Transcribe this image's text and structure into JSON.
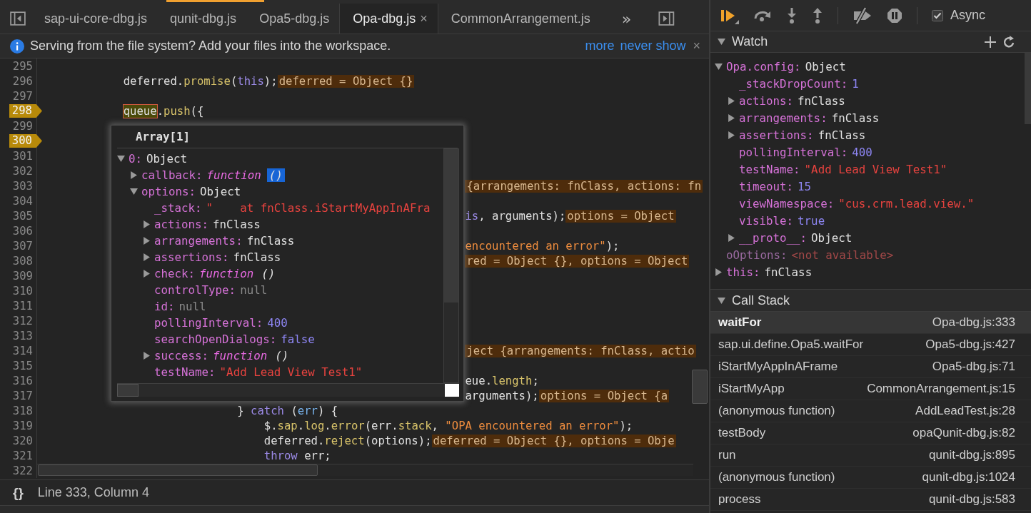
{
  "tabs": [
    {
      "label": "sap-ui-core-dbg.js",
      "selected": false
    },
    {
      "label": "qunit-dbg.js",
      "selected": false
    },
    {
      "label": "Opa5-dbg.js",
      "selected": false
    },
    {
      "label": "Opa-dbg.js",
      "selected": true,
      "close": "×"
    },
    {
      "label": "CommonArrangement.js",
      "selected": false
    }
  ],
  "tab_overflow": "»",
  "infobar": {
    "message": "Serving from the file system? Add your files into the workspace.",
    "links": [
      "more",
      "never show"
    ],
    "close": "×"
  },
  "code_lines": [
    {
      "number": "295",
      "breakpoint": false
    },
    {
      "number": "296",
      "breakpoint": false,
      "code": [
        {
          "kind": "plain",
          "t": "            deferred."
        },
        {
          "kind": "method",
          "t": "promise"
        },
        {
          "kind": "plain",
          "t": "("
        },
        {
          "kind": "keyword",
          "t": "this"
        },
        {
          "kind": "plain",
          "t": ");"
        }
      ],
      "value": "deferred = Object {}"
    },
    {
      "number": "297",
      "breakpoint": false
    },
    {
      "number": "298",
      "breakpoint": true,
      "code": [
        {
          "kind": "hover",
          "t": "            queue"
        },
        {
          "kind": "plain",
          "t": "."
        },
        {
          "kind": "method",
          "t": "push"
        },
        {
          "kind": "plain",
          "t": "({"
        }
      ]
    },
    {
      "number": "299",
      "breakpoint": false
    },
    {
      "number": "300",
      "breakpoint": true
    },
    {
      "number": "301",
      "breakpoint": false
    },
    {
      "number": "302",
      "breakpoint": false
    },
    {
      "number": "303",
      "breakpoint": false,
      "value": "                                                               {arrangements: fnClass, actions: fn"
    },
    {
      "number": "304",
      "breakpoint": false
    },
    {
      "number": "305",
      "breakpoint": false,
      "code": [
        {
          "kind": "keyword",
          "t": "                                                               is"
        },
        {
          "kind": "plain",
          "t": ", arguments);"
        }
      ],
      "value": "options = Object"
    },
    {
      "number": "306",
      "breakpoint": false
    },
    {
      "number": "307",
      "breakpoint": false,
      "code": [
        {
          "kind": "string",
          "t": "                                                               encountered an error\""
        },
        {
          "kind": "plain",
          "t": ");"
        }
      ]
    },
    {
      "number": "308",
      "breakpoint": false,
      "value": "                                                               red = Object {}, options = Object"
    },
    {
      "number": "309",
      "breakpoint": false
    },
    {
      "number": "310",
      "breakpoint": false
    },
    {
      "number": "311",
      "breakpoint": false
    },
    {
      "number": "312",
      "breakpoint": false
    },
    {
      "number": "313",
      "breakpoint": false
    },
    {
      "number": "314",
      "breakpoint": false,
      "value": "                                                               ject {arrangements: fnClass, actio"
    },
    {
      "number": "315",
      "breakpoint": false
    },
    {
      "number": "316",
      "breakpoint": false,
      "code": [
        {
          "kind": "plain",
          "t": "                                                               eue."
        },
        {
          "kind": "method",
          "t": "length"
        },
        {
          "kind": "plain",
          "t": ";"
        }
      ]
    },
    {
      "number": "317",
      "breakpoint": false,
      "code": [
        {
          "kind": "plain",
          "t": "                                                               arguments);"
        }
      ],
      "value": "options = Object {a"
    },
    {
      "number": "318",
      "breakpoint": false,
      "code": [
        {
          "kind": "plain",
          "t": "                             } "
        },
        {
          "kind": "keyword",
          "t": "catch"
        },
        {
          "kind": "plain",
          "t": " ("
        },
        {
          "kind": "param",
          "t": "err"
        },
        {
          "kind": "plain",
          "t": ") {"
        }
      ]
    },
    {
      "number": "319",
      "breakpoint": false,
      "code": [
        {
          "kind": "plain",
          "t": "                                 $."
        },
        {
          "kind": "method",
          "t": "sap"
        },
        {
          "kind": "plain",
          "t": "."
        },
        {
          "kind": "method",
          "t": "log"
        },
        {
          "kind": "plain",
          "t": "."
        },
        {
          "kind": "method",
          "t": "error"
        },
        {
          "kind": "plain",
          "t": "(err."
        },
        {
          "kind": "method",
          "t": "stack"
        },
        {
          "kind": "plain",
          "t": ", "
        },
        {
          "kind": "string",
          "t": "\"OPA encountered an error\""
        },
        {
          "kind": "plain",
          "t": ");"
        }
      ]
    },
    {
      "number": "320",
      "breakpoint": false,
      "code": [
        {
          "kind": "plain",
          "t": "                                 deferred."
        },
        {
          "kind": "method",
          "t": "reject"
        },
        {
          "kind": "plain",
          "t": "(options);"
        }
      ],
      "value": "deferred = Object {}, options = Obje"
    },
    {
      "number": "321",
      "breakpoint": false,
      "code": [
        {
          "kind": "keyword",
          "t": "                                 throw"
        },
        {
          "kind": "plain",
          "t": " err;"
        }
      ]
    },
    {
      "number": "322",
      "breakpoint": false
    }
  ],
  "popover": {
    "title": "Array[1]",
    "tree": [
      {
        "name": "0:",
        "kind": "object",
        "value": "Object",
        "expanded": true,
        "children": [
          {
            "name": "callback:",
            "kind": "function",
            "value": "function",
            "args": "()",
            "args_selected": true,
            "expanded": false
          },
          {
            "name": "options:",
            "kind": "object",
            "value": "Object",
            "expanded": true,
            "children": [
              {
                "name": "_stack:",
                "kind": "string",
                "value": "\"    at fnClass.iStartMyAppInAFra"
              },
              {
                "name": "actions:",
                "kind": "object",
                "value": "fnClass",
                "expanded": false
              },
              {
                "name": "arrangements:",
                "kind": "object",
                "value": "fnClass",
                "expanded": false
              },
              {
                "name": "assertions:",
                "kind": "object",
                "value": "fnClass",
                "expanded": false
              },
              {
                "name": "check:",
                "kind": "function",
                "value": "function",
                "args": "()",
                "args_selected": false,
                "expanded": false
              },
              {
                "name": "controlType:",
                "kind": "null",
                "value": "null"
              },
              {
                "name": "id:",
                "kind": "null",
                "value": "null"
              },
              {
                "name": "pollingInterval:",
                "kind": "number",
                "value": "400"
              },
              {
                "name": "searchOpenDialogs:",
                "kind": "boolean",
                "value": "false"
              },
              {
                "name": "success:",
                "kind": "function",
                "value": "function",
                "args": "()",
                "args_selected": false,
                "expanded": false
              },
              {
                "name": "testName:",
                "kind": "string",
                "value": "\"Add Lead View Test1\""
              }
            ]
          }
        ]
      }
    ]
  },
  "status_bar": {
    "format_icon": "{}",
    "position": "Line 333, Column 4"
  },
  "async": {
    "label": "Async",
    "checked": true
  },
  "watch": {
    "title": "Watch",
    "items": [
      {
        "name": "Opa.config:",
        "kind": "object",
        "value": "Object",
        "expanded": true,
        "children": [
          {
            "name": "_stackDropCount:",
            "kind": "number",
            "value": "1"
          },
          {
            "name": "actions:",
            "kind": "object",
            "value": "fnClass",
            "expanded": false
          },
          {
            "name": "arrangements:",
            "kind": "object",
            "value": "fnClass",
            "expanded": false
          },
          {
            "name": "assertions:",
            "kind": "object",
            "value": "fnClass",
            "expanded": false
          },
          {
            "name": "pollingInterval:",
            "kind": "number",
            "value": "400"
          },
          {
            "name": "testName:",
            "kind": "string",
            "value": "\"Add Lead View Test1\""
          },
          {
            "name": "timeout:",
            "kind": "number",
            "value": "15"
          },
          {
            "name": "viewNamespace:",
            "kind": "string",
            "value": "\"cus.crm.lead.view.\""
          },
          {
            "name": "visible:",
            "kind": "boolean",
            "value": "true"
          },
          {
            "name": "__proto__:",
            "kind": "object",
            "value": "Object",
            "expanded": false
          }
        ]
      },
      {
        "name": "oOptions:",
        "kind": "unavailable",
        "value": "<not available>"
      },
      {
        "name": "this:",
        "kind": "object",
        "value": "fnClass",
        "expanded": false
      }
    ]
  },
  "call_stack": {
    "title": "Call Stack",
    "frames": [
      {
        "name": "waitFor",
        "location": "Opa-dbg.js:333",
        "selected": true
      },
      {
        "name": "sap.ui.define.Opa5.waitFor",
        "location": "Opa5-dbg.js:427",
        "selected": false
      },
      {
        "name": "iStartMyAppInAFrame",
        "location": "Opa5-dbg.js:71",
        "selected": false
      },
      {
        "name": "iStartMyApp",
        "location": "CommonArrangement.js:15",
        "selected": false
      },
      {
        "name": "(anonymous function)",
        "location": "AddLeadTest.js:28",
        "selected": false
      },
      {
        "name": "testBody",
        "location": "opaQunit-dbg.js:82",
        "selected": false
      },
      {
        "name": "run",
        "location": "qunit-dbg.js:895",
        "selected": false
      },
      {
        "name": "(anonymous function)",
        "location": "qunit-dbg.js:1024",
        "selected": false
      },
      {
        "name": "process",
        "location": "qunit-dbg.js:583",
        "selected": false
      }
    ]
  }
}
